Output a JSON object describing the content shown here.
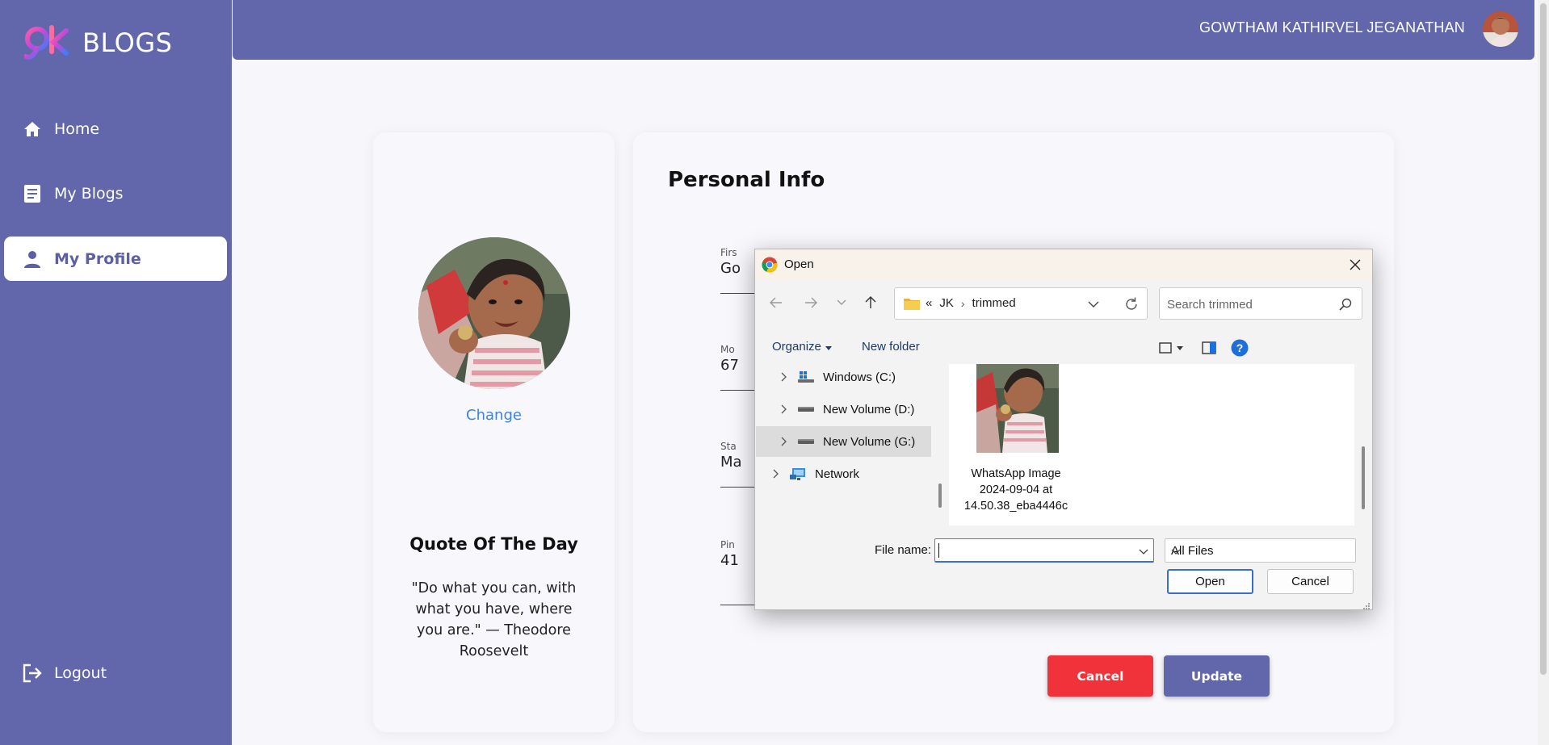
{
  "app": {
    "brand": "BLOGS",
    "accent_color": "#6266aa",
    "danger_color": "#f0323a"
  },
  "sidebar": {
    "items": [
      {
        "label": "Home",
        "icon": "home-icon",
        "active": false
      },
      {
        "label": "My Blogs",
        "icon": "document-icon",
        "active": false
      },
      {
        "label": "My Profile",
        "icon": "person-icon",
        "active": true
      }
    ],
    "logout_label": "Logout"
  },
  "header": {
    "user_name": "GOWTHAM KATHIRVEL JEGANATHAN"
  },
  "profile": {
    "change_label": "Change",
    "quote_title": "Quote Of The Day",
    "quote_text": "\"Do what you can, with what you have, where you are.\" — Theodore Roosevelt"
  },
  "personal_info": {
    "title": "Personal Info",
    "fields": [
      {
        "label": "Firs",
        "value": "Go"
      },
      {
        "label": "Mo",
        "value": "67"
      },
      {
        "label": "Sta",
        "value": "Ma"
      },
      {
        "label": "Pin",
        "value": "41"
      }
    ],
    "cancel_label": "Cancel",
    "update_label": "Update"
  },
  "dialog": {
    "title": "Open",
    "breadcrumb": [
      "«",
      "JK",
      "trimmed"
    ],
    "search_placeholder": "Search trimmed",
    "organize_label": "Organize",
    "new_folder_label": "New folder",
    "tree": [
      {
        "label": "Windows (C:)",
        "icon": "windows-drive-icon",
        "selected": false
      },
      {
        "label": "New Volume (D:)",
        "icon": "drive-icon",
        "selected": false
      },
      {
        "label": "New Volume (G:)",
        "icon": "drive-icon",
        "selected": true
      },
      {
        "label": "Network",
        "icon": "network-icon",
        "selected": false
      }
    ],
    "files": [
      {
        "name": "WhatsApp Image 2024-09-04 at 14.50.38_eba4446c"
      }
    ],
    "file_name_label": "File name:",
    "file_name_value": "",
    "file_type_value": "All Files",
    "open_label": "Open",
    "cancel_label": "Cancel"
  }
}
